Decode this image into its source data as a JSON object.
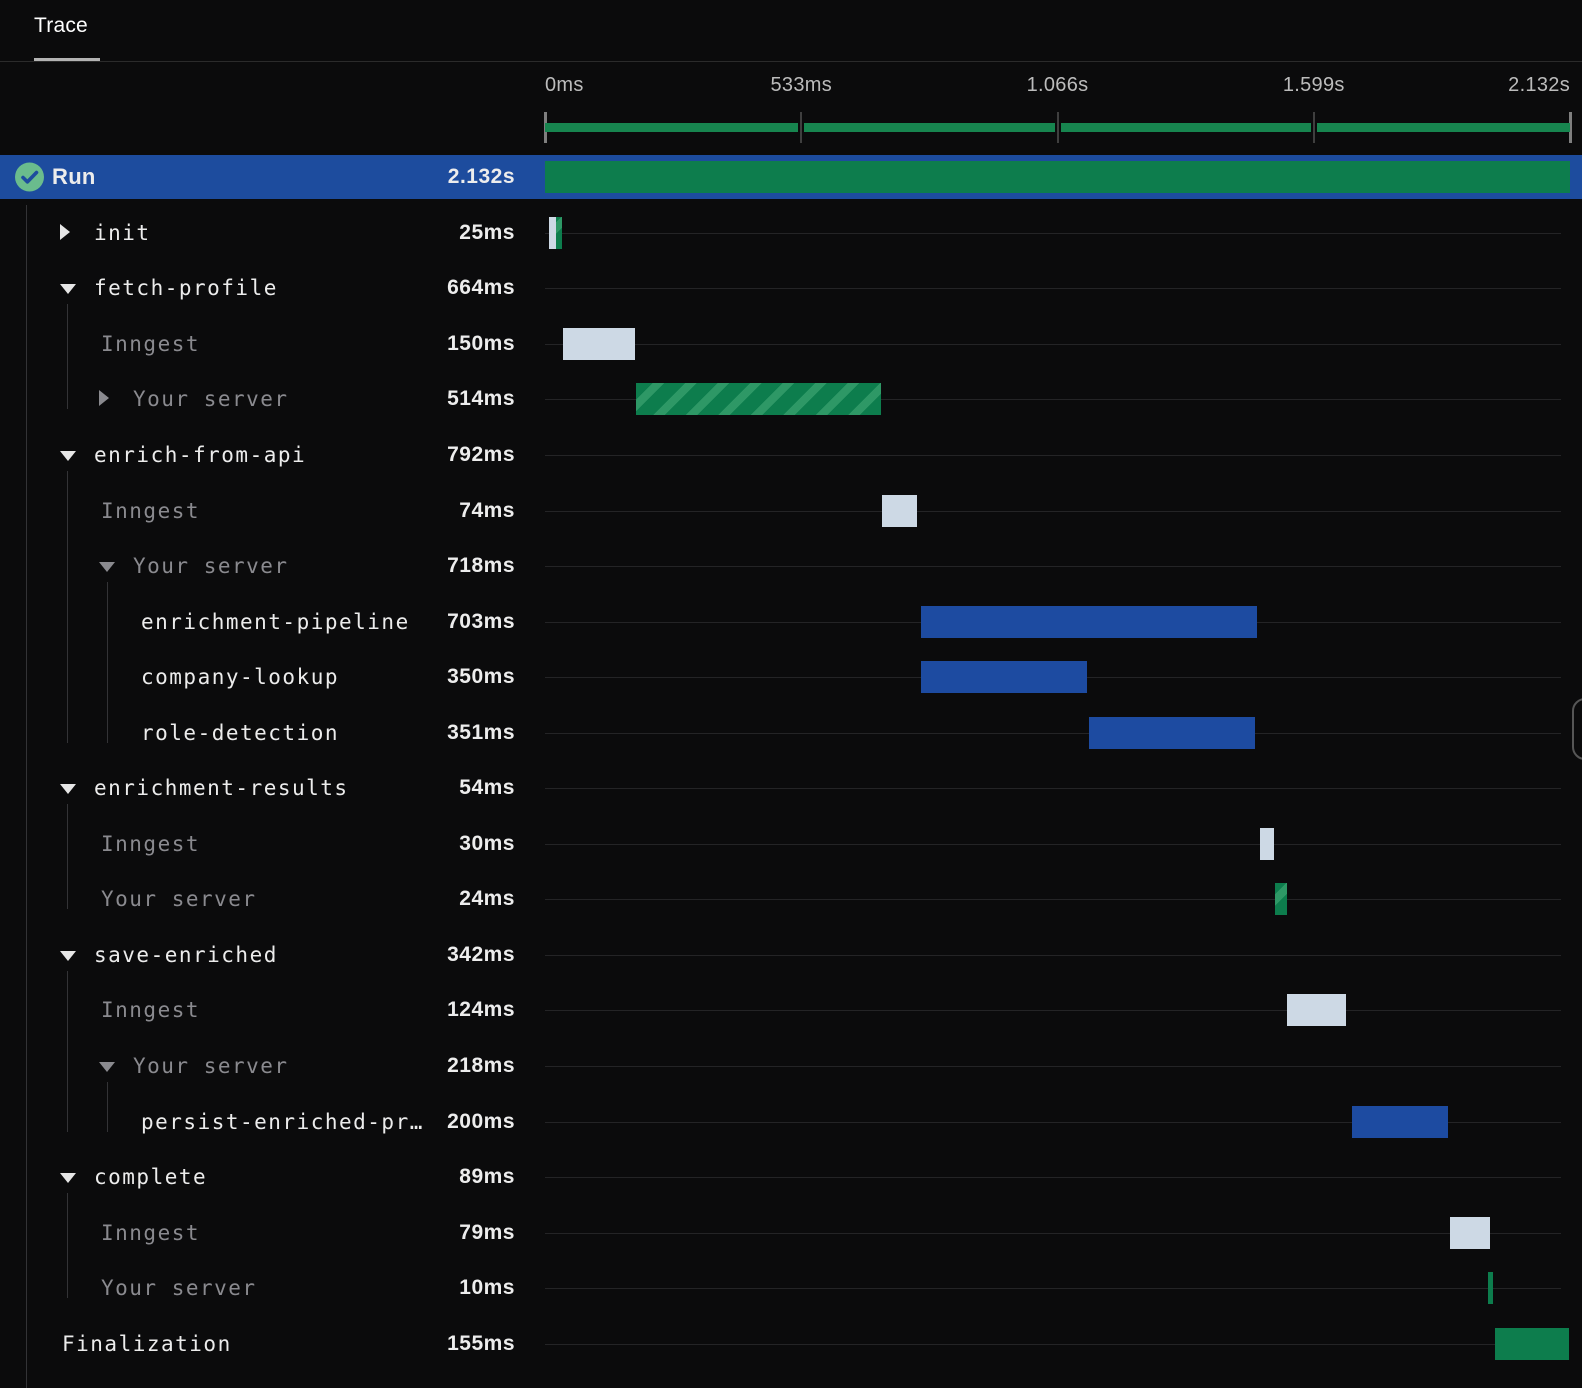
{
  "tab": {
    "label": "Trace"
  },
  "timeline": {
    "total_ms": 2132,
    "tick_labels": [
      "0ms",
      "533ms",
      "1.066s",
      "1.599s",
      "2.132s"
    ]
  },
  "colors": {
    "accent_blue": "#1d4c9e",
    "bar_blue": "#1d4ba1",
    "bar_green": "#0d7d4d",
    "bar_green_stripe": "#2e9866",
    "bar_queue": "#cdd9e5",
    "minimap_green": "#17854f",
    "check_green": "#6abc8d"
  },
  "run": {
    "status_icon": "check-circle",
    "label": "Run",
    "duration": "2.132s"
  },
  "rows": [
    {
      "label": "Run",
      "duration": "2.132s",
      "depth": 0,
      "variant": "run",
      "selected": true,
      "arrow": null,
      "bars": [
        {
          "type": "server",
          "start": 0,
          "end": 2132
        }
      ]
    },
    {
      "label": "init",
      "duration": "25ms",
      "depth": 1,
      "variant": "step",
      "arrow": "collapsed",
      "bars": [
        {
          "type": "queue",
          "start": 8,
          "end": 22
        },
        {
          "type": "server-hatched",
          "start": 22,
          "end": 35
        }
      ]
    },
    {
      "label": "fetch-profile",
      "duration": "664ms",
      "depth": 1,
      "variant": "step",
      "arrow": "expanded",
      "bars": []
    },
    {
      "label": "Inngest",
      "duration": "150ms",
      "depth": 2,
      "variant": "inngest",
      "arrow": null,
      "bars": [
        {
          "type": "queue",
          "start": 37,
          "end": 187
        }
      ]
    },
    {
      "label": "Your server",
      "duration": "514ms",
      "depth": 2,
      "variant": "server",
      "arrow": "collapsed",
      "bars": [
        {
          "type": "server-hatched",
          "start": 190,
          "end": 698
        }
      ]
    },
    {
      "label": "enrich-from-api",
      "duration": "792ms",
      "depth": 1,
      "variant": "step",
      "arrow": "expanded",
      "bars": []
    },
    {
      "label": "Inngest",
      "duration": "74ms",
      "depth": 2,
      "variant": "inngest",
      "arrow": null,
      "bars": [
        {
          "type": "queue",
          "start": 700,
          "end": 774
        }
      ]
    },
    {
      "label": "Your server",
      "duration": "718ms",
      "depth": 2,
      "variant": "server",
      "arrow": "expanded",
      "bars": []
    },
    {
      "label": "enrichment-pipeline",
      "duration": "703ms",
      "depth": 3,
      "variant": "step",
      "arrow": null,
      "bars": [
        {
          "type": "exec",
          "start": 782,
          "end": 1481
        }
      ]
    },
    {
      "label": "company-lookup",
      "duration": "350ms",
      "depth": 3,
      "variant": "step",
      "arrow": null,
      "bars": [
        {
          "type": "exec",
          "start": 782,
          "end": 1127
        }
      ]
    },
    {
      "label": "role-detection",
      "duration": "351ms",
      "depth": 3,
      "variant": "step",
      "arrow": null,
      "bars": [
        {
          "type": "exec",
          "start": 1131,
          "end": 1477
        }
      ]
    },
    {
      "label": "enrichment-results",
      "duration": "54ms",
      "depth": 1,
      "variant": "step",
      "arrow": "expanded",
      "bars": []
    },
    {
      "label": "Inngest",
      "duration": "30ms",
      "depth": 2,
      "variant": "inngest",
      "arrow": null,
      "bars": [
        {
          "type": "queue",
          "start": 1487,
          "end": 1517
        }
      ]
    },
    {
      "label": "Your server",
      "duration": "24ms",
      "depth": 2,
      "variant": "server",
      "arrow": null,
      "bars": [
        {
          "type": "server-hatched",
          "start": 1519,
          "end": 1543
        }
      ]
    },
    {
      "label": "save-enriched",
      "duration": "342ms",
      "depth": 1,
      "variant": "step",
      "arrow": "expanded",
      "bars": []
    },
    {
      "label": "Inngest",
      "duration": "124ms",
      "depth": 2,
      "variant": "inngest",
      "arrow": null,
      "bars": [
        {
          "type": "queue",
          "start": 1543,
          "end": 1667
        }
      ]
    },
    {
      "label": "Your server",
      "duration": "218ms",
      "depth": 2,
      "variant": "server",
      "arrow": "expanded",
      "bars": []
    },
    {
      "label": "persist-enriched-pr…",
      "duration": "200ms",
      "depth": 3,
      "variant": "step",
      "arrow": null,
      "bars": [
        {
          "type": "exec",
          "start": 1678,
          "end": 1878
        }
      ]
    },
    {
      "label": "complete",
      "duration": "89ms",
      "depth": 1,
      "variant": "step",
      "arrow": "expanded",
      "bars": []
    },
    {
      "label": "Inngest",
      "duration": "79ms",
      "depth": 2,
      "variant": "inngest",
      "arrow": null,
      "bars": [
        {
          "type": "queue",
          "start": 1882,
          "end": 1966
        }
      ]
    },
    {
      "label": "Your server",
      "duration": "10ms",
      "depth": 2,
      "variant": "server",
      "arrow": null,
      "bars": [
        {
          "type": "server",
          "start": 1961,
          "end": 1971
        }
      ]
    },
    {
      "label": "Finalization",
      "duration": "155ms",
      "depth": 0,
      "variant": "step",
      "arrow": null,
      "bars": [
        {
          "type": "server",
          "start": 1975,
          "end": 2130
        }
      ]
    }
  ],
  "guides": [
    {
      "level": 0,
      "from_row": 1,
      "to_row": 21,
      "full_height": true
    },
    {
      "level": 1,
      "from_row": 3,
      "to_row": 4
    },
    {
      "level": 1,
      "from_row": 6,
      "to_row": 10
    },
    {
      "level": 2,
      "from_row": 8,
      "to_row": 10
    },
    {
      "level": 1,
      "from_row": 12,
      "to_row": 13
    },
    {
      "level": 1,
      "from_row": 15,
      "to_row": 17
    },
    {
      "level": 2,
      "from_row": 17,
      "to_row": 17
    },
    {
      "level": 1,
      "from_row": 19,
      "to_row": 20
    }
  ]
}
